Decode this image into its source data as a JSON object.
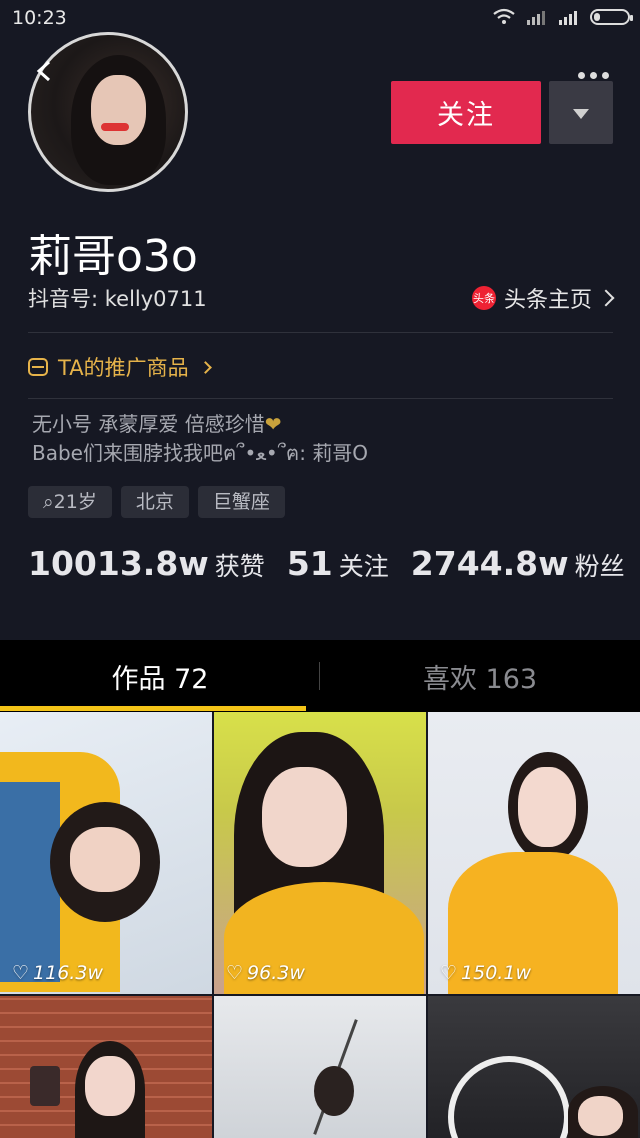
{
  "status_bar": {
    "time": "10:23"
  },
  "profile": {
    "username": "莉哥o3o",
    "douyin_id": "抖音号: kelly0711",
    "follow_label": "关注",
    "toutiao_logo_text": "头条",
    "toutiao_label": "头条主页",
    "promo_label": "TA的推广商品",
    "bio_line1": "无小号 承蒙厚爱 倍感珍惜",
    "bio_line2": "Babe们来围脖找我吧ฅ՞•ﻌ•՞ฅ: 莉哥O",
    "tags": [
      "21岁",
      "北京",
      "巨蟹座"
    ]
  },
  "stats": {
    "likes_num": "10013.8w",
    "likes_label": "获赞",
    "following_num": "51",
    "following_label": "关注",
    "fans_num": "2744.8w",
    "fans_label": "粉丝"
  },
  "tabs": {
    "works": "作品 72",
    "liked": "喜欢 163"
  },
  "videos": [
    {
      "likes": "116.3w"
    },
    {
      "likes": "96.3w"
    },
    {
      "likes": "150.1w"
    },
    {
      "likes": ""
    },
    {
      "likes": ""
    },
    {
      "likes": ""
    }
  ],
  "colors": {
    "background": "#161823",
    "follow_button": "#e2294f",
    "accent_gold": "#e6b34a",
    "tab_underline": "#f5c518"
  },
  "icons": [
    "back-icon",
    "more-icon",
    "dropdown-icon",
    "toutiao-logo-icon",
    "bag-icon",
    "location-pin-icon",
    "heart-icon"
  ]
}
